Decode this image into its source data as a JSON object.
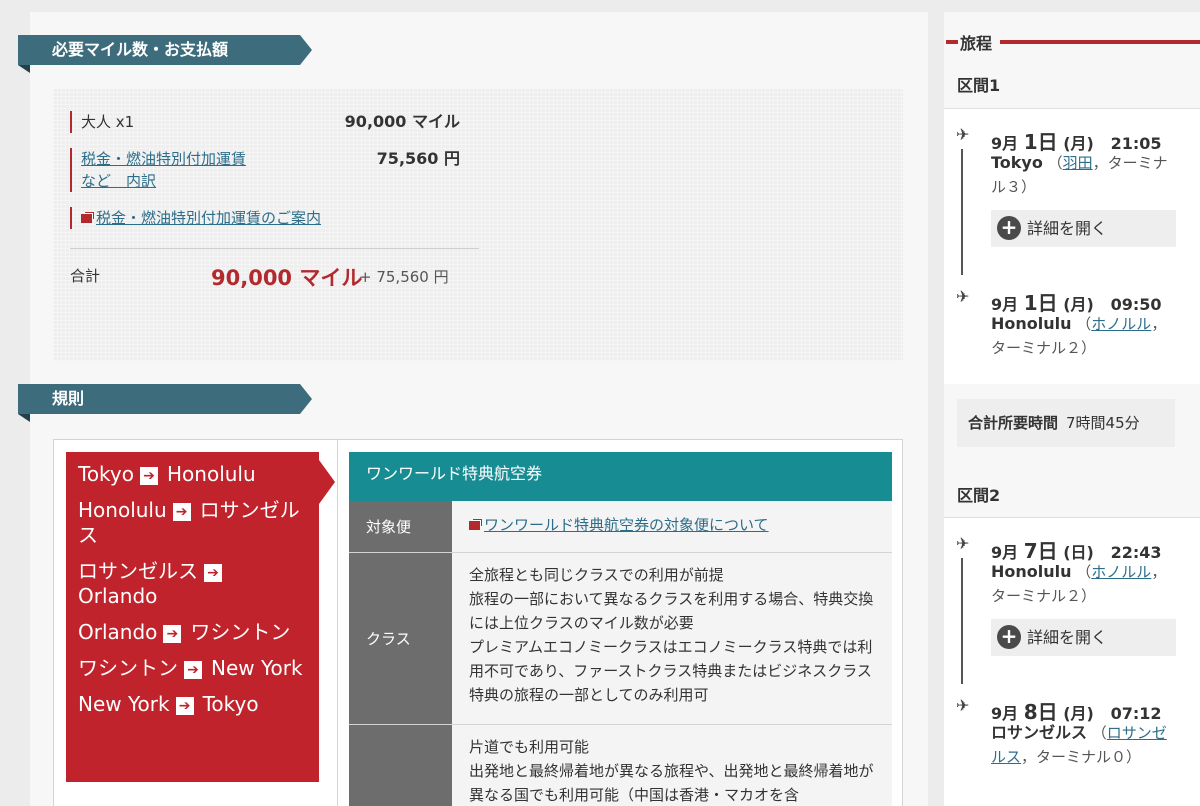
{
  "payment": {
    "section_title": "必要マイル数・お支払額",
    "adult_label": "大人 x1",
    "adult_value": "90,000 マイル",
    "tax_label_line1": "税金・燃油特別付加運賃",
    "tax_label_line2": "など　内訳",
    "tax_value": "75,560 円",
    "tax_guide_link": "税金・燃油特別付加運賃のご案内",
    "total_label": "合計",
    "total_miles": "90,000 マイル",
    "total_yen": "+ 75,560 円"
  },
  "rules": {
    "section_title": "規則",
    "routes": [
      {
        "from": "Tokyo",
        "to": "Honolulu"
      },
      {
        "from": "Honolulu",
        "to": "ロサンゼルス"
      },
      {
        "from": "ロサンゼルス",
        "to": "Orlando"
      },
      {
        "from": "Orlando",
        "to": "ワシントン"
      },
      {
        "from": "ワシントン",
        "to": "New York"
      },
      {
        "from": "New York",
        "to": "Tokyo"
      }
    ],
    "fare_name": "ワンワールド特典航空券",
    "rows": [
      {
        "key": "対象便",
        "link": "ワンワールド特典航空券の対象便について"
      },
      {
        "key": "クラス",
        "lines": [
          "全旅程とも同じクラスでの利用が前提",
          "旅程の一部において異なるクラスを利用する場合、特典交換には上位クラスのマイル数が必要",
          "プレミアムエコノミークラスはエコノミークラス特典では利用不可であり、ファーストクラス特典またはビジネスクラス特典の旅程の一部としてのみ利用可"
        ]
      },
      {
        "key": "",
        "lines": [
          "片道でも利用可能",
          "出発地と最終帰着地が異なる旅程や、出発地と最終帰着地が異なる国でも利用可能（中国は香港・マカオを含"
        ]
      }
    ]
  },
  "itinerary": {
    "title": "旅程",
    "segment1_label": "区間1",
    "segment2_label": "区間2",
    "dep1": {
      "month": "9月",
      "day": "1日",
      "dow": "(月)",
      "time": "21:05",
      "city": "Tokyo",
      "airport": "羽田",
      "terminal": "ターミナル３）"
    },
    "arr1": {
      "month": "9月",
      "day": "1日",
      "dow": "(月)",
      "time": "09:50",
      "city": "Honolulu",
      "airport": "ホノルル",
      "terminal": "ターミナル２）"
    },
    "dep2": {
      "month": "9月",
      "day": "7日",
      "dow": "(日)",
      "time": "22:43",
      "city": "Honolulu",
      "airport": "ホノルル",
      "terminal": "ターミナル２）"
    },
    "arr2": {
      "month": "9月",
      "day": "8日",
      "dow": "(月)",
      "time": "07:12",
      "city": "ロサンゼルス",
      "airport": "ロサンゼルス",
      "terminal": "ターミナル０）"
    },
    "detail_button": "詳細を開く",
    "total_time_label": "合計所要時間",
    "total_time_value": "7時間45分"
  }
}
